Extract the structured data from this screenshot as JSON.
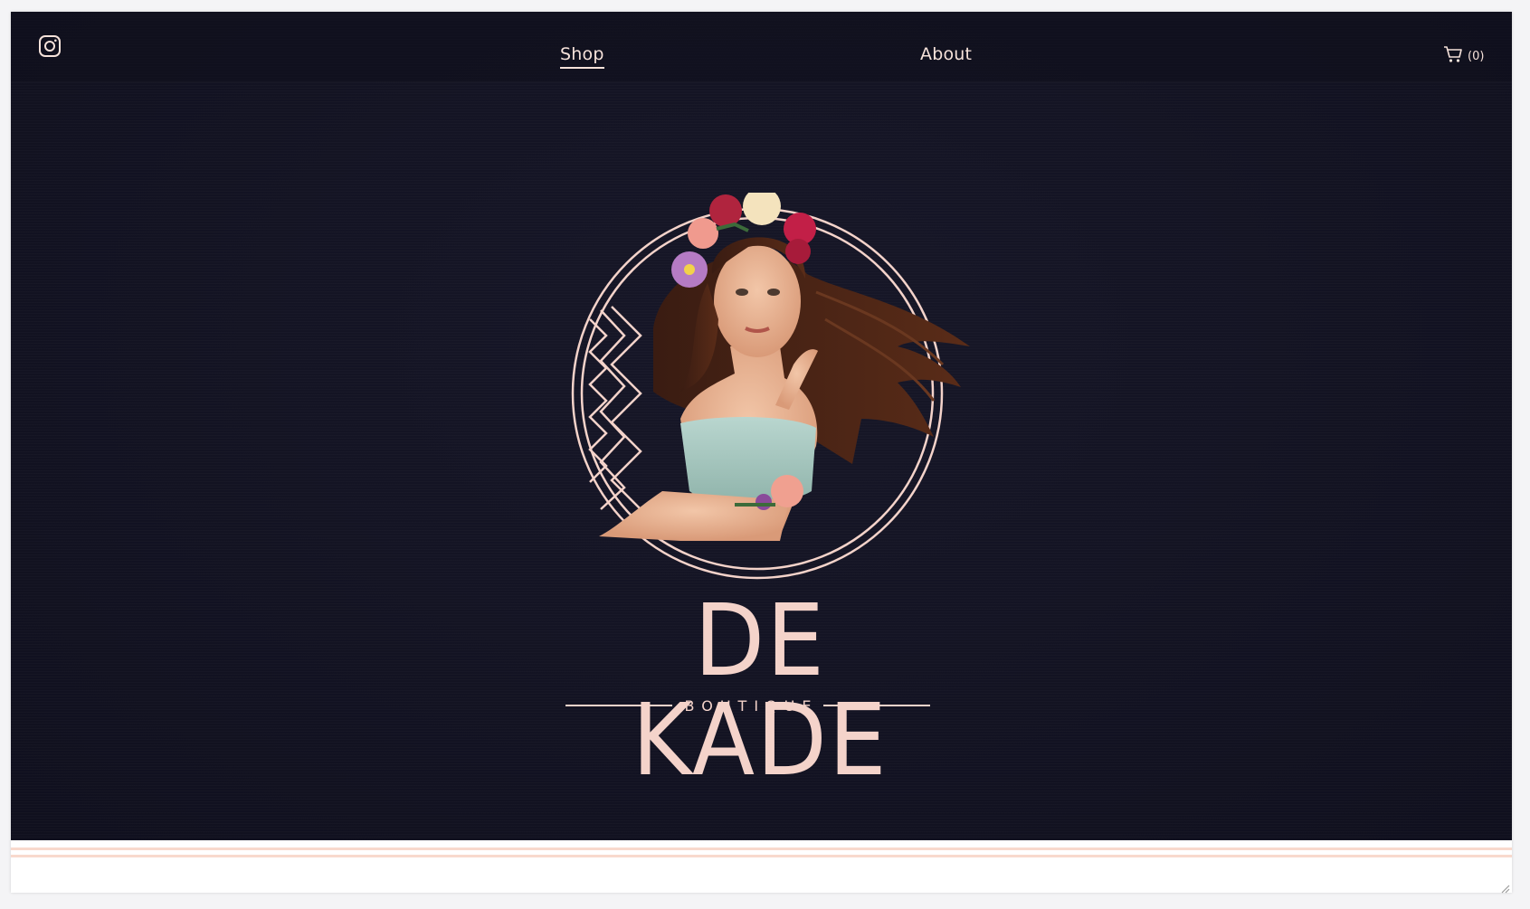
{
  "header": {
    "instagram_icon": "instagram-icon",
    "nav": {
      "shop_label": "Shop",
      "about_label": "About"
    },
    "cart": {
      "icon": "cart-icon",
      "count_label": "(0)"
    }
  },
  "hero": {
    "logo": {
      "brand_name": "DE KADE",
      "tagline": "BOUTIQUE"
    }
  },
  "colors": {
    "background": "#141424",
    "accent": "#f4d3ca",
    "footer_stripe": "#f8d9cd"
  }
}
